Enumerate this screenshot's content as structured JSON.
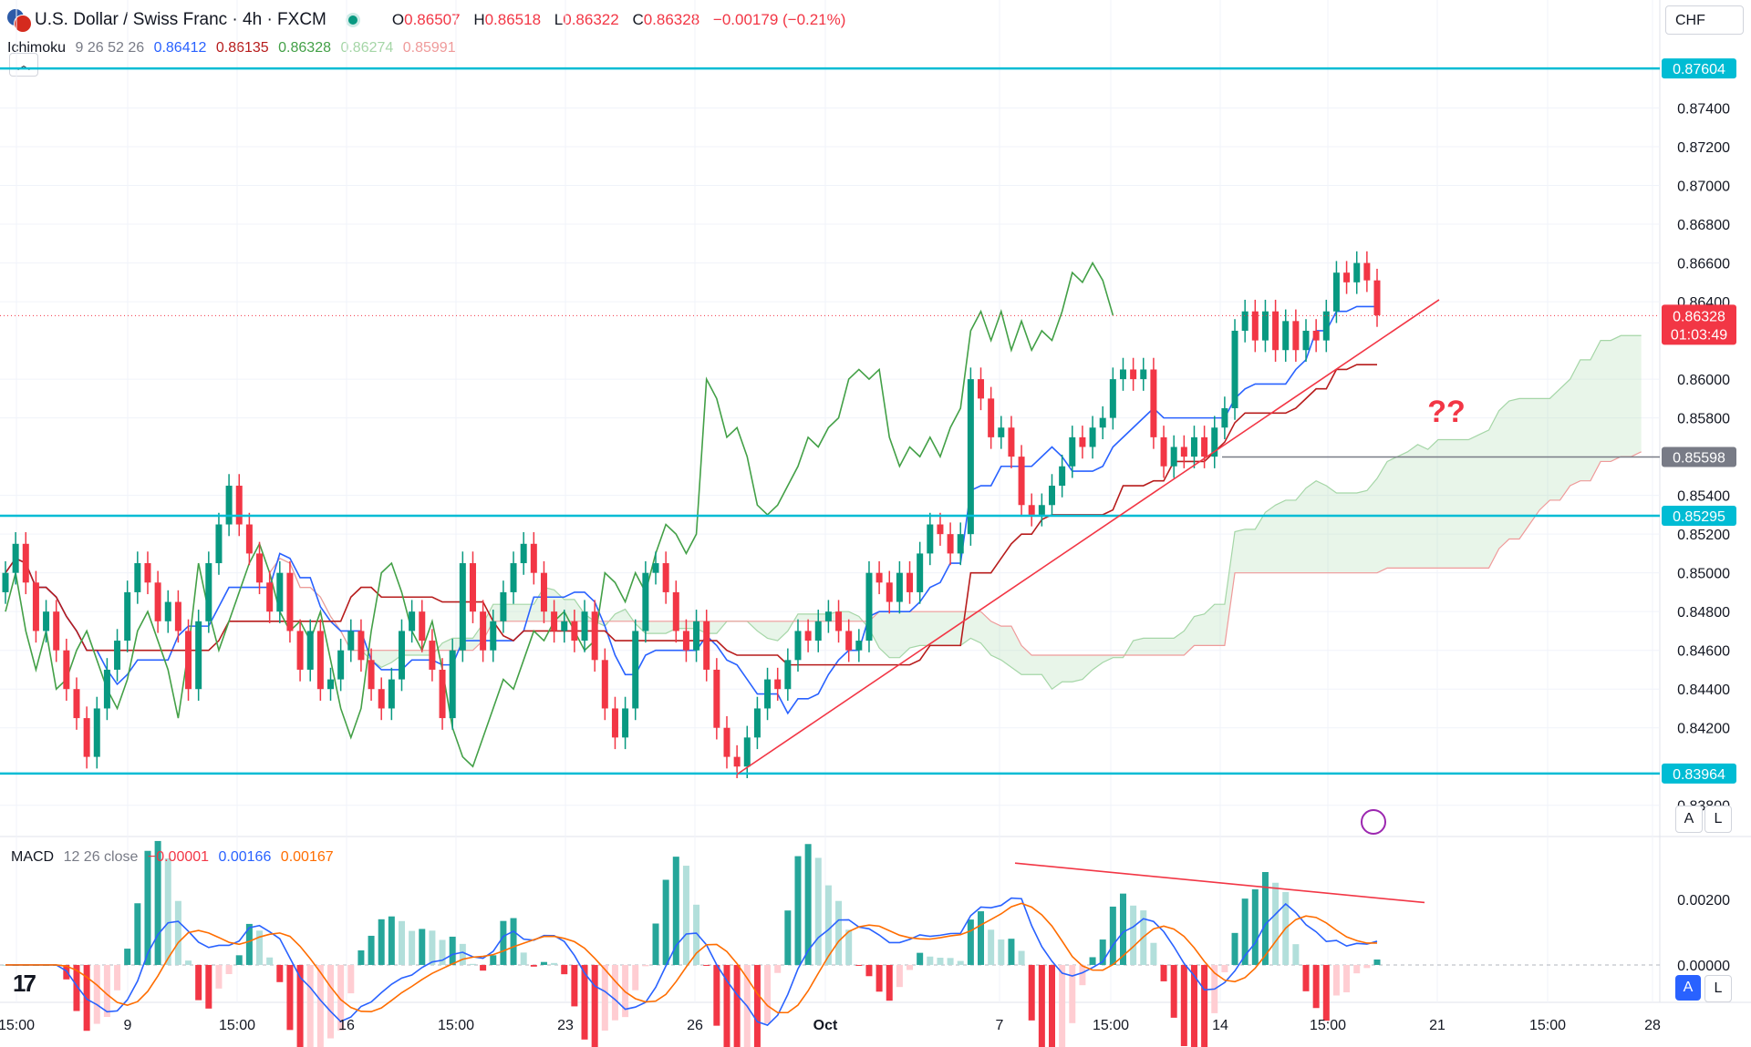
{
  "header": {
    "symbol_title": "U.S. Dollar / Swiss Franc · 4h · FXCM",
    "ohlc": [
      {
        "key": "O",
        "value": "0.86507"
      },
      {
        "key": "H",
        "value": "0.86518"
      },
      {
        "key": "L",
        "value": "0.86322"
      },
      {
        "key": "C",
        "value": "0.86328"
      }
    ],
    "change": "−0.00179 (−0.21%)",
    "currency": "CHF"
  },
  "ichimoku": {
    "label": "Ichimoku",
    "params": "9 26 52 26",
    "values": [
      "0.86412",
      "0.86135",
      "0.86328",
      "0.86274",
      "0.85991"
    ],
    "colors": [
      "#2962ff",
      "#b71c1c",
      "#43a047",
      "#a5d6a7",
      "#ef9a9a"
    ]
  },
  "macd": {
    "label": "MACD",
    "params": "12 26 close",
    "values": [
      "−0.00001",
      "0.00166",
      "0.00167"
    ],
    "colors": [
      "#f23645",
      "#2962ff",
      "#ff6d00"
    ]
  },
  "annotation": "??",
  "scale_buttons": {
    "auto": "A",
    "log": "L"
  },
  "colors": {
    "up": "#089981",
    "down": "#f23645",
    "level_line": "#00bcd4",
    "trendline": "#f23645",
    "tenkan": "#2962ff",
    "kijun": "#b71c1c",
    "chikou": "#43a047",
    "cloud_bull": "#a5d6a7",
    "cloud_bear": "#ef9a9a"
  },
  "chart_data": {
    "type": "candlestick",
    "title": "U.S. Dollar / Swiss Franc · 4h · FXCM",
    "y_axis": {
      "ticks": [
        "0.87400",
        "0.87200",
        "0.87000",
        "0.86800",
        "0.86600",
        "0.86400",
        "0.86000",
        "0.85800",
        "0.85400",
        "0.85200",
        "0.85000",
        "0.84800",
        "0.84600",
        "0.84400",
        "0.84200",
        "0.83800"
      ],
      "ylim": [
        0.837,
        0.8776
      ]
    },
    "x_axis": {
      "ticks": [
        "15:00",
        "9",
        "15:00",
        "16",
        "15:00",
        "23",
        "26",
        "Oct",
        "7",
        "15:00",
        "14",
        "15:00",
        "21",
        "15:00",
        "28"
      ]
    },
    "levels": [
      {
        "label": "0.87604",
        "value": 0.87604,
        "kind": "horizontal"
      },
      {
        "label": "0.85295",
        "value": 0.85295,
        "kind": "horizontal"
      },
      {
        "label": "0.83964",
        "value": 0.83964,
        "kind": "horizontal"
      },
      {
        "label": "0.85598",
        "value": 0.85598,
        "kind": "horizontal-gray"
      }
    ],
    "current_price": {
      "label": "0.86328",
      "countdown": "01:03:49",
      "value": 0.86328
    },
    "candles_summary": "Approx. 150 four-hour bars from early September to mid-October; range 0.8392–0.8665",
    "candles": [
      [
        0.849,
        0.85
      ],
      [
        0.85,
        0.8515
      ],
      [
        0.8515,
        0.8495
      ],
      [
        0.8495,
        0.847
      ],
      [
        0.847,
        0.848
      ],
      [
        0.848,
        0.846
      ],
      [
        0.846,
        0.844
      ],
      [
        0.844,
        0.8425
      ],
      [
        0.8425,
        0.8405
      ],
      [
        0.8405,
        0.843
      ],
      [
        0.843,
        0.845
      ],
      [
        0.845,
        0.8465
      ],
      [
        0.8465,
        0.849
      ],
      [
        0.849,
        0.8505
      ],
      [
        0.8505,
        0.8495
      ],
      [
        0.8495,
        0.8475
      ],
      [
        0.8475,
        0.8485
      ],
      [
        0.8485,
        0.847
      ],
      [
        0.847,
        0.844
      ],
      [
        0.844,
        0.8475
      ],
      [
        0.8475,
        0.8505
      ],
      [
        0.8505,
        0.8525
      ],
      [
        0.8525,
        0.8545
      ],
      [
        0.8545,
        0.8525
      ],
      [
        0.8525,
        0.851
      ],
      [
        0.851,
        0.8495
      ],
      [
        0.8495,
        0.848
      ],
      [
        0.848,
        0.85
      ],
      [
        0.85,
        0.847
      ],
      [
        0.847,
        0.845
      ],
      [
        0.845,
        0.847
      ],
      [
        0.847,
        0.844
      ],
      [
        0.844,
        0.8445
      ],
      [
        0.8445,
        0.846
      ],
      [
        0.846,
        0.847
      ],
      [
        0.847,
        0.8455
      ],
      [
        0.8455,
        0.844
      ],
      [
        0.844,
        0.843
      ],
      [
        0.843,
        0.8445
      ],
      [
        0.8445,
        0.847
      ],
      [
        0.847,
        0.848
      ],
      [
        0.848,
        0.8465
      ],
      [
        0.8465,
        0.845
      ],
      [
        0.845,
        0.8425
      ],
      [
        0.8425,
        0.846
      ],
      [
        0.846,
        0.8505
      ],
      [
        0.8505,
        0.848
      ],
      [
        0.848,
        0.846
      ],
      [
        0.846,
        0.8475
      ],
      [
        0.8475,
        0.849
      ],
      [
        0.849,
        0.8505
      ],
      [
        0.8505,
        0.8515
      ],
      [
        0.8515,
        0.85
      ],
      [
        0.85,
        0.848
      ],
      [
        0.848,
        0.847
      ],
      [
        0.847,
        0.8475
      ],
      [
        0.8475,
        0.8465
      ],
      [
        0.8465,
        0.848
      ],
      [
        0.848,
        0.8455
      ],
      [
        0.8455,
        0.843
      ],
      [
        0.843,
        0.8415
      ],
      [
        0.8415,
        0.843
      ],
      [
        0.843,
        0.847
      ],
      [
        0.847,
        0.85
      ],
      [
        0.85,
        0.8505
      ],
      [
        0.8505,
        0.849
      ],
      [
        0.849,
        0.847
      ],
      [
        0.847,
        0.846
      ],
      [
        0.846,
        0.8475
      ],
      [
        0.8475,
        0.845
      ],
      [
        0.845,
        0.842
      ],
      [
        0.842,
        0.8405
      ],
      [
        0.8405,
        0.84
      ],
      [
        0.84,
        0.8415
      ],
      [
        0.8415,
        0.843
      ],
      [
        0.843,
        0.8445
      ],
      [
        0.8445,
        0.844
      ],
      [
        0.844,
        0.8455
      ],
      [
        0.8455,
        0.847
      ],
      [
        0.847,
        0.8465
      ],
      [
        0.8465,
        0.8475
      ],
      [
        0.8475,
        0.848
      ],
      [
        0.848,
        0.847
      ],
      [
        0.847,
        0.846
      ],
      [
        0.846,
        0.8465
      ],
      [
        0.8465,
        0.85
      ],
      [
        0.85,
        0.8495
      ],
      [
        0.8495,
        0.8485
      ],
      [
        0.8485,
        0.85
      ],
      [
        0.85,
        0.849
      ],
      [
        0.849,
        0.851
      ],
      [
        0.851,
        0.8525
      ],
      [
        0.8525,
        0.852
      ],
      [
        0.852,
        0.851
      ],
      [
        0.851,
        0.852
      ],
      [
        0.852,
        0.86
      ],
      [
        0.86,
        0.859
      ],
      [
        0.859,
        0.857
      ],
      [
        0.857,
        0.8575
      ],
      [
        0.8575,
        0.856
      ],
      [
        0.856,
        0.8535
      ],
      [
        0.8535,
        0.853
      ],
      [
        0.853,
        0.8535
      ],
      [
        0.8535,
        0.8545
      ],
      [
        0.8545,
        0.8555
      ],
      [
        0.8555,
        0.857
      ],
      [
        0.857,
        0.8565
      ],
      [
        0.8565,
        0.8575
      ],
      [
        0.8575,
        0.858
      ],
      [
        0.858,
        0.86
      ],
      [
        0.86,
        0.8605
      ],
      [
        0.8605,
        0.86
      ],
      [
        0.86,
        0.8605
      ],
      [
        0.8605,
        0.857
      ],
      [
        0.857,
        0.8555
      ],
      [
        0.8555,
        0.8565
      ],
      [
        0.8565,
        0.856
      ],
      [
        0.856,
        0.857
      ],
      [
        0.857,
        0.856
      ],
      [
        0.856,
        0.8575
      ],
      [
        0.8575,
        0.8585
      ],
      [
        0.8585,
        0.8625
      ],
      [
        0.8625,
        0.8635
      ],
      [
        0.8635,
        0.862
      ],
      [
        0.862,
        0.8635
      ],
      [
        0.8635,
        0.8615
      ],
      [
        0.8615,
        0.863
      ],
      [
        0.863,
        0.8615
      ],
      [
        0.8615,
        0.8625
      ],
      [
        0.8625,
        0.862
      ],
      [
        0.862,
        0.8635
      ],
      [
        0.8635,
        0.8655
      ],
      [
        0.8655,
        0.865
      ],
      [
        0.865,
        0.866
      ],
      [
        0.866,
        0.8651
      ],
      [
        0.8651,
        0.8633
      ]
    ],
    "series_overview": [
      {
        "name": "Tenkan-sen",
        "last": 0.86412
      },
      {
        "name": "Kijun-sen",
        "last": 0.86135
      },
      {
        "name": "Chikou span",
        "last": 0.86328
      },
      {
        "name": "Senkou span A",
        "last": 0.86274
      },
      {
        "name": "Senkou span B",
        "last": 0.85991
      }
    ],
    "macd_panel": {
      "y_ticks": [
        "0.00200",
        "0.00000"
      ],
      "ylim": [
        -0.001,
        0.0033
      ],
      "histogram_last": -1e-05,
      "macd_last": 0.00166,
      "signal_last": 0.00167
    }
  }
}
